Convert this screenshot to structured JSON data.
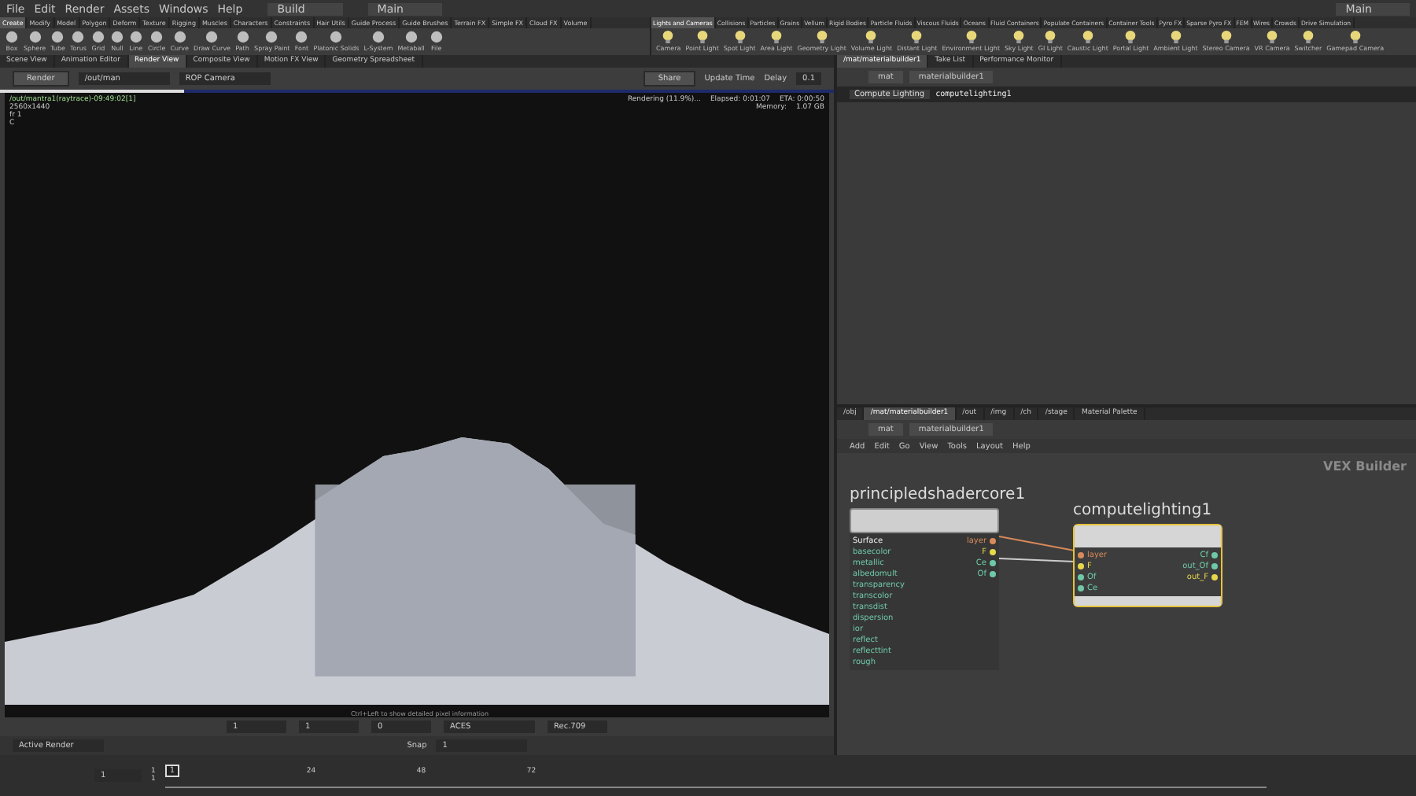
{
  "menu_bar": {
    "items": [
      "File",
      "Edit",
      "Render",
      "Assets",
      "Windows",
      "Help"
    ],
    "desktop": "Build",
    "context": "Main",
    "right_context": "Main"
  },
  "shelf_left": {
    "tabs": [
      {
        "label": "Create",
        "selected": true
      },
      {
        "label": "Modify",
        "selected": false
      },
      {
        "label": "Model",
        "selected": false
      },
      {
        "label": "Polygon",
        "selected": false
      },
      {
        "label": "Deform",
        "selected": false
      },
      {
        "label": "Texture",
        "selected": false
      },
      {
        "label": "Rigging",
        "selected": false
      },
      {
        "label": "Muscles",
        "selected": false
      },
      {
        "label": "Characters",
        "selected": false
      },
      {
        "label": "Constraints",
        "selected": false
      },
      {
        "label": "Hair Utils",
        "selected": false
      },
      {
        "label": "Guide Process",
        "selected": false
      },
      {
        "label": "Guide Brushes",
        "selected": false
      },
      {
        "label": "Terrain FX",
        "selected": false
      },
      {
        "label": "Simple FX",
        "selected": false
      },
      {
        "label": "Cloud FX",
        "selected": false
      },
      {
        "label": "Volume",
        "selected": false
      }
    ],
    "tools": [
      "Box",
      "Sphere",
      "Tube",
      "Torus",
      "Grid",
      "Null",
      "Line",
      "Circle",
      "Curve",
      "Draw Curve",
      "Path",
      "Spray Paint",
      "Font",
      "Platonic Solids",
      "L-System",
      "Metaball",
      "File"
    ]
  },
  "shelf_right": {
    "tabs": [
      {
        "label": "Lights and Cameras",
        "selected": true
      },
      {
        "label": "Collisions",
        "selected": false
      },
      {
        "label": "Particles",
        "selected": false
      },
      {
        "label": "Grains",
        "selected": false
      },
      {
        "label": "Vellum",
        "selected": false
      },
      {
        "label": "Rigid Bodies",
        "selected": false
      },
      {
        "label": "Particle Fluids",
        "selected": false
      },
      {
        "label": "Viscous Fluids",
        "selected": false
      },
      {
        "label": "Oceans",
        "selected": false
      },
      {
        "label": "Fluid Containers",
        "selected": false
      },
      {
        "label": "Populate Containers",
        "selected": false
      },
      {
        "label": "Container Tools",
        "selected": false
      },
      {
        "label": "Pyro FX",
        "selected": false
      },
      {
        "label": "Sparse Pyro FX",
        "selected": false
      },
      {
        "label": "FEM",
        "selected": false
      },
      {
        "label": "Wires",
        "selected": false
      },
      {
        "label": "Crowds",
        "selected": false
      },
      {
        "label": "Drive Simulation",
        "selected": false
      }
    ],
    "tools": [
      "Camera",
      "Point Light",
      "Spot Light",
      "Area Light",
      "Geometry Light",
      "Volume Light",
      "Distant Light",
      "Environment Light",
      "Sky Light",
      "GI Light",
      "Caustic Light",
      "Portal Light",
      "Ambient Light",
      "Stereo Camera",
      "VR Camera",
      "Switcher",
      "Gamepad Camera"
    ]
  },
  "viewer": {
    "tabs": [
      {
        "label": "Scene View",
        "selected": false
      },
      {
        "label": "Animation Editor",
        "selected": false
      },
      {
        "label": "Render View",
        "selected": true
      },
      {
        "label": "Composite View",
        "selected": false
      },
      {
        "label": "Motion FX View",
        "selected": false
      },
      {
        "label": "Geometry Spreadsheet",
        "selected": false
      }
    ],
    "render_button": "Render",
    "rop": "/out/man",
    "camera": "ROP Camera",
    "share": "Share",
    "update_time": "Update Time",
    "delay_label": "Delay",
    "delay": "0.1",
    "level": 0.22,
    "info": {
      "path": "/out/mantra1(raytrace)-09:49:02[1]",
      "resolution": "2560x1440",
      "frame": "fr 1",
      "channel": "C",
      "status": "Rendering (11.9%)...",
      "elapsed": "Elapsed: 0:01:07",
      "eta": "ETA: 0:00:50",
      "memory_label": "Memory:",
      "memory": "1.07 GB"
    },
    "hint": "Ctrl+Left to show detailed pixel information",
    "fields": [
      "1",
      "1",
      "0"
    ],
    "color_space": "ACES",
    "display": "Rec.709",
    "active_render": "Active Render",
    "snap_label": "Snap",
    "snap": "1"
  },
  "timeline": {
    "current_frame": "1",
    "range_start": "1",
    "range_end": "1",
    "marker": "1",
    "ticks": [
      "24",
      "48",
      "72"
    ]
  },
  "parm_pane": {
    "tabs": [
      {
        "label": "/mat/materialbuilder1",
        "selected": true
      },
      {
        "label": "Take List",
        "selected": false
      },
      {
        "label": "Performance Monitor",
        "selected": false
      }
    ],
    "path": [
      "mat",
      "materialbuilder1"
    ],
    "node_type": "Compute Lighting",
    "node_name": "computelighting1"
  },
  "network": {
    "tabs": [
      {
        "label": "/obj",
        "selected": false
      },
      {
        "label": "/mat/materialbuilder1",
        "selected": true
      },
      {
        "label": "/out",
        "selected": false
      },
      {
        "label": "/img",
        "selected": false
      },
      {
        "label": "/ch",
        "selected": false
      },
      {
        "label": "/stage",
        "selected": false
      },
      {
        "label": "Material Palette",
        "selected": false
      }
    ],
    "path": [
      "mat",
      "materialbuilder1"
    ],
    "menu": [
      "Add",
      "Edit",
      "Go",
      "View",
      "Tools",
      "Layout",
      "Help"
    ],
    "context_label": "VEX Builder",
    "nodes": [
      {
        "name": "principledshadercore1",
        "selected": false,
        "section": "Surface",
        "inputs": [
          "basecolor",
          "metallic",
          "albedomult",
          "transparency",
          "transcolor",
          "transdist",
          "dispersion",
          "ior",
          "reflect",
          "reflecttint",
          "rough"
        ],
        "outputs": [
          {
            "name": "layer",
            "color": "#d88a5a"
          },
          {
            "name": "F",
            "color": "#e6d84a"
          },
          {
            "name": "Ce",
            "color": "#6fc9a8"
          },
          {
            "name": "Of",
            "color": "#6fc9a8"
          }
        ]
      },
      {
        "name": "computelighting1",
        "selected": true,
        "inputs": [
          {
            "name": "layer",
            "color": "#d88a5a"
          },
          {
            "name": "F",
            "color": "#e6d84a"
          },
          {
            "name": "Of",
            "color": "#6fc9a8"
          },
          {
            "name": "Ce",
            "color": "#6fc9a8"
          }
        ],
        "outputs": [
          {
            "name": "Cf",
            "color": "#6fc9a8"
          },
          {
            "name": "out_Of",
            "color": "#6fc9a8"
          },
          {
            "name": "out_F",
            "color": "#e6d84a"
          }
        ]
      }
    ]
  }
}
